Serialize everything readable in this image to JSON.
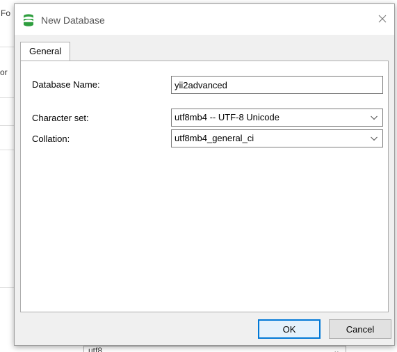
{
  "background": {
    "frag_top": "Fo",
    "frag_mid": "or",
    "bottom_field": "utf8"
  },
  "dialog": {
    "title": "New Database",
    "tabs": [
      {
        "label": "General"
      }
    ],
    "fields": {
      "database_name": {
        "label": "Database Name:",
        "value": "yii2advanced"
      },
      "character_set": {
        "label": "Character set:",
        "value": "utf8mb4 -- UTF-8 Unicode"
      },
      "collation": {
        "label": "Collation:",
        "value": "utf8mb4_general_ci"
      }
    },
    "buttons": {
      "ok": "OK",
      "cancel": "Cancel"
    }
  },
  "colors": {
    "accent": "#0078d7",
    "icon_green": "#2e9e3e",
    "dialog_bg": "#f0f0f0"
  },
  "icons": {
    "title": "database-icon",
    "close": "close-icon",
    "dropdown": "chevron-down-icon"
  }
}
